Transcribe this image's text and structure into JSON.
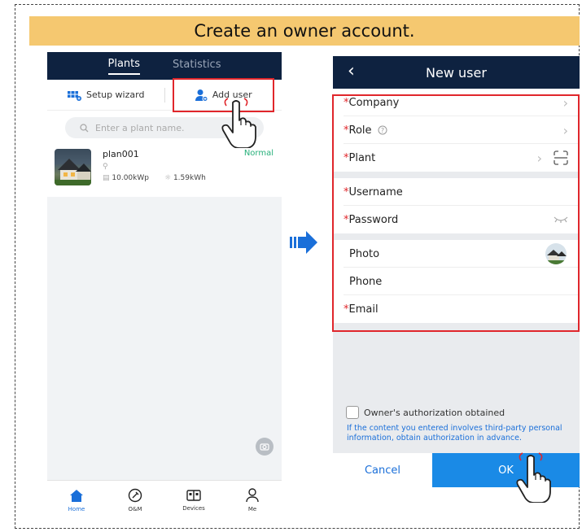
{
  "banner": {
    "title": "Create an owner account."
  },
  "left_app": {
    "tabs": [
      {
        "label": "Plants",
        "active": true
      },
      {
        "label": "Statistics",
        "active": false
      }
    ],
    "actions": {
      "setup_wizard": "Setup wizard",
      "add_user": "Add user"
    },
    "search": {
      "placeholder": "Enter a plant name."
    },
    "plant": {
      "name": "plan001",
      "status": "Normal",
      "capacity": "10.00kWp",
      "energy": "1.59kWh"
    },
    "nav": [
      {
        "label": "Home",
        "icon": "home-icon",
        "active": true
      },
      {
        "label": "O&M",
        "icon": "om-icon",
        "active": false
      },
      {
        "label": "Devices",
        "icon": "devices-icon",
        "active": false
      },
      {
        "label": "Me",
        "icon": "person-icon",
        "active": false
      }
    ]
  },
  "right_app": {
    "header": {
      "title": "New user"
    },
    "fields": {
      "company": "Company",
      "role": "Role",
      "plant": "Plant",
      "username": "Username",
      "password": "Password",
      "photo": "Photo",
      "phone": "Phone",
      "email": "Email"
    },
    "required_mark": "*",
    "authorization": {
      "checkbox_label": "Owner's authorization obtained",
      "checked": false,
      "note": "If the content you entered involves third-party personal information, obtain authorization in advance."
    },
    "buttons": {
      "cancel": "Cancel",
      "ok": "OK"
    }
  },
  "colors": {
    "header_navy": "#0e2240",
    "highlight_red": "#e0262b",
    "banner": "#f5c870",
    "accent_blue": "#1a8ae6",
    "status_green": "#27b07a"
  }
}
